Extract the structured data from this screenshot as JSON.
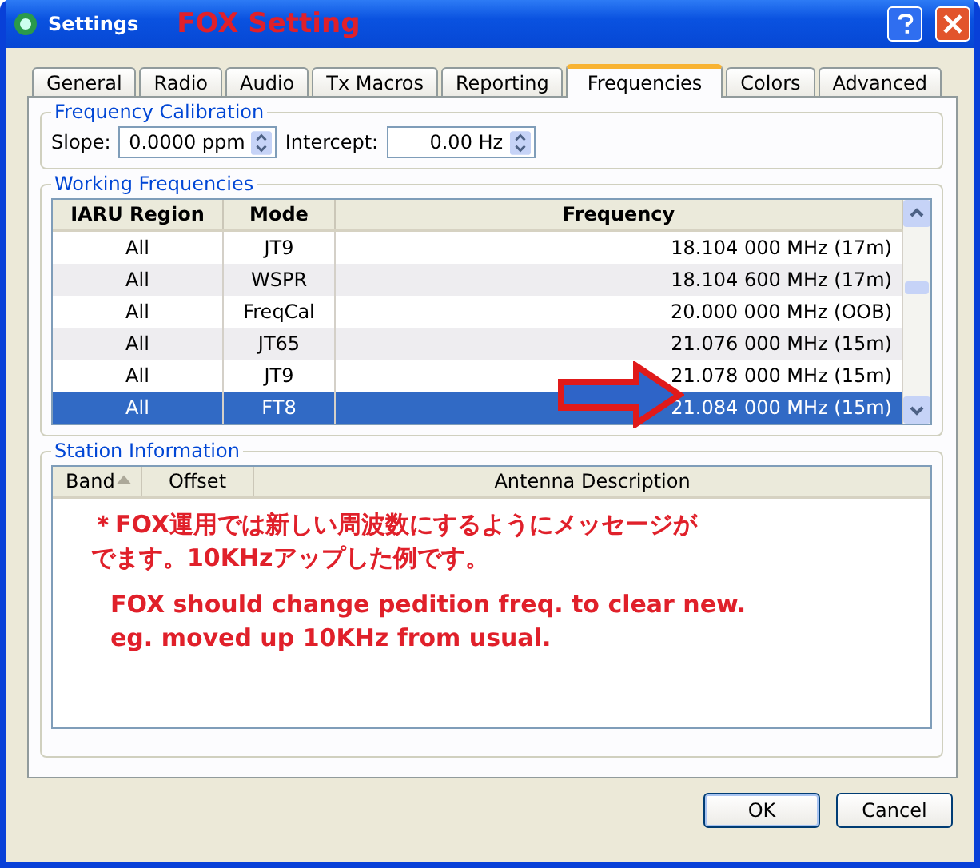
{
  "window": {
    "title": "Settings",
    "annotation": "FOX Setting"
  },
  "tabs": [
    {
      "label": "General",
      "selected": false
    },
    {
      "label": "Radio",
      "selected": false
    },
    {
      "label": "Audio",
      "selected": false
    },
    {
      "label": "Tx Macros",
      "selected": false
    },
    {
      "label": "Reporting",
      "selected": false
    },
    {
      "label": "Frequencies",
      "selected": true
    },
    {
      "label": "Colors",
      "selected": false
    },
    {
      "label": "Advanced",
      "selected": false
    }
  ],
  "frequency_calibration": {
    "title": "Frequency Calibration",
    "slope_label": "Slope:",
    "slope": "0.0000 ppm",
    "intercept_label": "Intercept:",
    "intercept": "0.00 Hz"
  },
  "working_frequencies": {
    "title": "Working Frequencies",
    "columns": [
      "IARU Region",
      "Mode",
      "Frequency"
    ],
    "rows": [
      {
        "cells": [
          "All",
          "JT9",
          "18.104 000 MHz (17m)"
        ],
        "selected": false
      },
      {
        "cells": [
          "All",
          "WSPR",
          "18.104 600 MHz (17m)"
        ],
        "selected": false
      },
      {
        "cells": [
          "All",
          "FreqCal",
          "20.000 000 MHz (OOB)"
        ],
        "selected": false
      },
      {
        "cells": [
          "All",
          "JT65",
          "21.076 000 MHz (15m)"
        ],
        "selected": false
      },
      {
        "cells": [
          "All",
          "JT9",
          "21.078 000 MHz (15m)"
        ],
        "selected": false
      },
      {
        "cells": [
          "All",
          "FT8",
          "21.084 000 MHz (15m)"
        ],
        "selected": true
      }
    ]
  },
  "station_information": {
    "title": "Station Information",
    "columns": [
      "Band",
      "Offset",
      "Antenna Description"
    ]
  },
  "annotations": [
    "＊FOX運用では新しい周波数にするようにメッセージがでます。10KHzアップした例です。",
    "FOX should change pedition freq. to clear new. eg. moved up 10KHz from usual."
  ],
  "buttons": [
    "OK",
    "Cancel"
  ]
}
